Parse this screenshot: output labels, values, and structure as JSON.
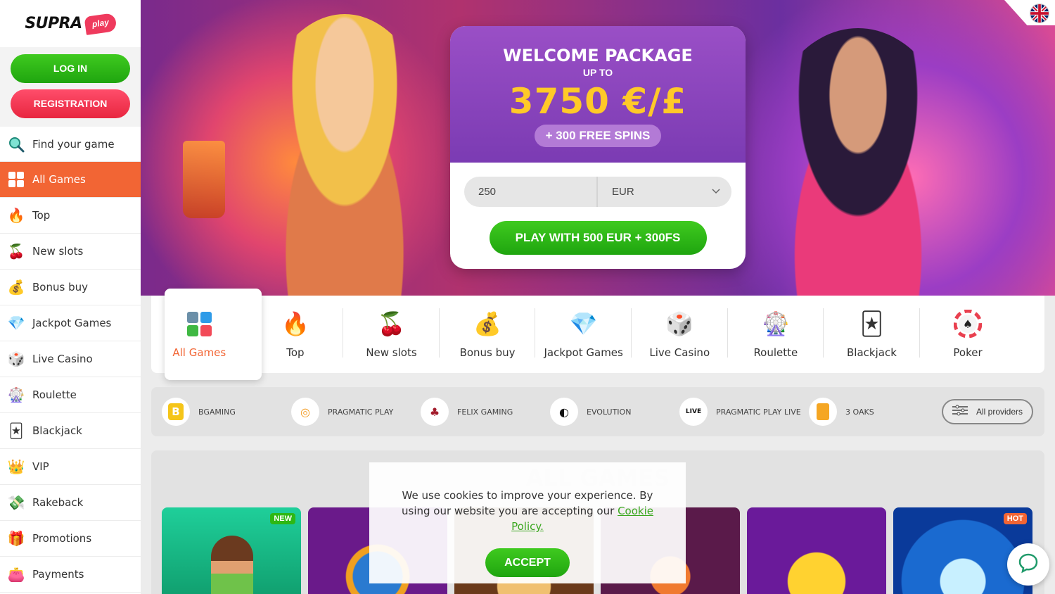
{
  "brand": {
    "name": "SUPRA",
    "play": "play"
  },
  "auth": {
    "login_label": "LOG IN",
    "register_label": "REGISTRATION"
  },
  "sidebar": {
    "items": [
      {
        "label": "Find your game",
        "icon": "search-icon"
      },
      {
        "label": "All Games",
        "icon": "grid-icon"
      },
      {
        "label": "Top",
        "icon": "fire-icon"
      },
      {
        "label": "New slots",
        "icon": "cherry-icon"
      },
      {
        "label": "Bonus buy",
        "icon": "money-bag-icon"
      },
      {
        "label": "Jackpot Games",
        "icon": "diamond-icon"
      },
      {
        "label": "Live Casino",
        "icon": "dice-icon"
      },
      {
        "label": "Roulette",
        "icon": "roulette-icon"
      },
      {
        "label": "Blackjack",
        "icon": "cards-icon"
      },
      {
        "label": "VIP",
        "icon": "crown-icon"
      },
      {
        "label": "Rakeback",
        "icon": "cash-icon"
      },
      {
        "label": "Promotions",
        "icon": "gift-icon"
      },
      {
        "label": "Payments",
        "icon": "wallet-icon"
      }
    ]
  },
  "promo": {
    "title": "WELCOME PACKAGE",
    "up_to": "UP TO",
    "amount": "3750 €/£",
    "spins": "+ 300 FREE SPINS",
    "amount_value": "250",
    "currency": "EUR",
    "play_label": "PLAY WITH 500 EUR + 300FS"
  },
  "categories": [
    {
      "label": "All Games",
      "icon": "grid-icon"
    },
    {
      "label": "Top",
      "icon": "fire-icon"
    },
    {
      "label": "New slots",
      "icon": "cherry-icon"
    },
    {
      "label": "Bonus buy",
      "icon": "money-bag-icon"
    },
    {
      "label": "Jackpot Games",
      "icon": "diamond-icon"
    },
    {
      "label": "Live Casino",
      "icon": "dice-icon"
    },
    {
      "label": "Roulette",
      "icon": "roulette-icon"
    },
    {
      "label": "Blackjack",
      "icon": "cards-icon"
    },
    {
      "label": "Poker",
      "icon": "poker-chip-icon"
    }
  ],
  "providers": [
    {
      "name": "BGAMING",
      "icon": "bgaming-icon"
    },
    {
      "name": "PRAGMATIC PLAY",
      "icon": "pragmatic-icon"
    },
    {
      "name": "FELIX GAMING",
      "icon": "felix-icon"
    },
    {
      "name": "EVOLUTION",
      "icon": "evolution-icon"
    },
    {
      "name": "PRAGMATIC PLAY LIVE",
      "icon": "pragmatic-live-icon"
    },
    {
      "name": "3 OAKS",
      "icon": "oaks-icon"
    }
  ],
  "all_providers_label": "All providers",
  "games": {
    "title": "ALL GAMES",
    "badges": {
      "new": "NEW",
      "hot": "HOT"
    }
  },
  "cookie": {
    "text": "We use cookies to improve your experience. By using our website you are accepting our",
    "link": "Cookie Policy.",
    "accept": "ACCEPT"
  },
  "colors": {
    "accent": "#f26534",
    "green": "#2db814",
    "red": "#ef3a5d",
    "gold": "#ffc928"
  }
}
